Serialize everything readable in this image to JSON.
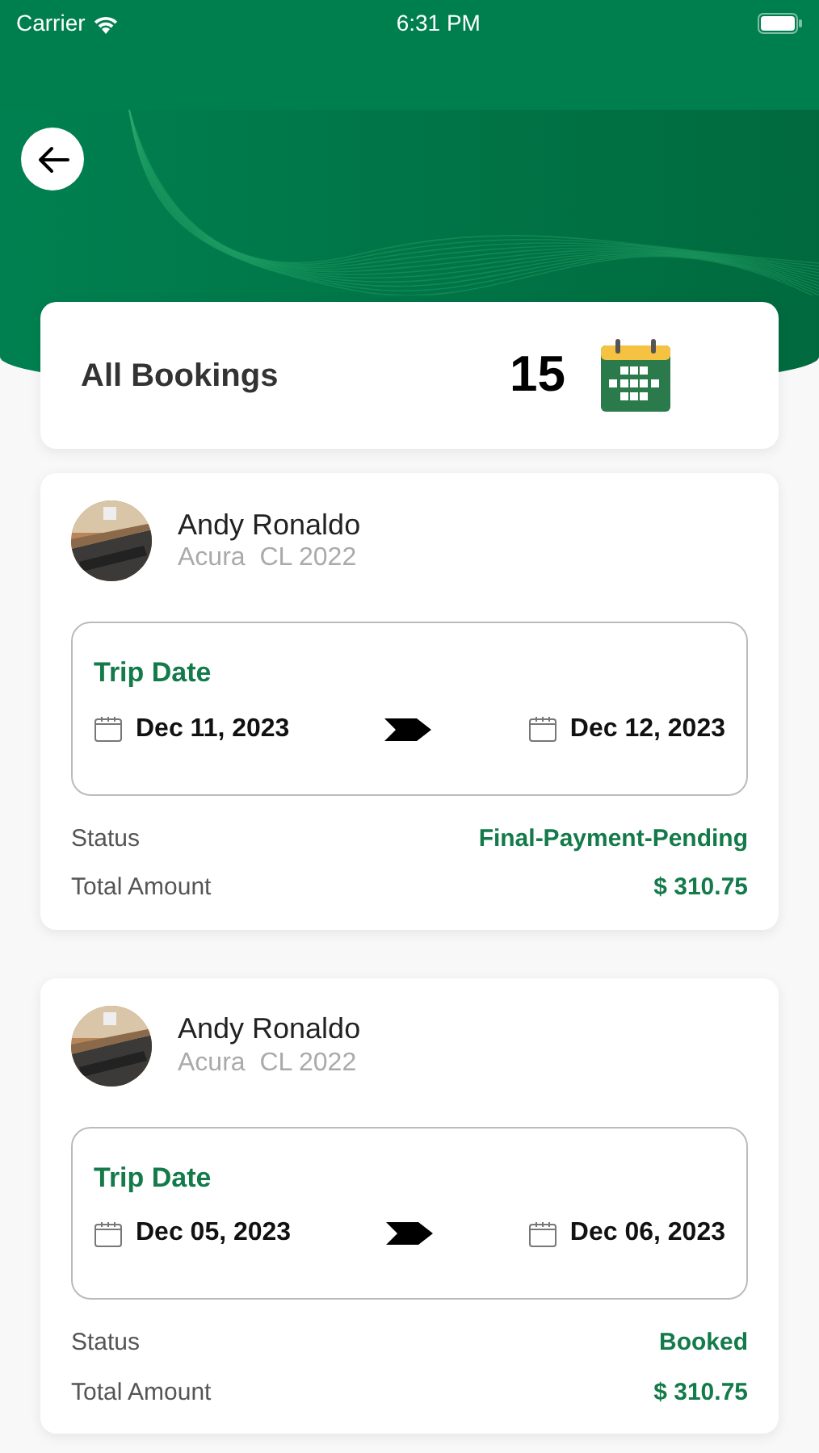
{
  "status_bar": {
    "carrier": "Carrier",
    "time": "6:31 PM"
  },
  "summary": {
    "label": "All Bookings",
    "count": "15"
  },
  "bookings": [
    {
      "name": "Andy Ronaldo",
      "vehicle": "Acura  CL 2022",
      "trip_label": "Trip Date",
      "start_date": "Dec 11, 2023",
      "end_date": "Dec 12, 2023",
      "status_label": "Status",
      "status": "Final-Payment-Pending",
      "amount_label": "Total Amount",
      "amount": "$ 310.75"
    },
    {
      "name": "Andy Ronaldo",
      "vehicle": "Acura  CL 2022",
      "trip_label": "Trip Date",
      "start_date": "Dec 05, 2023",
      "end_date": "Dec 06, 2023",
      "status_label": "Status",
      "status": "Booked",
      "amount_label": "Total Amount",
      "amount": "$ 310.75"
    }
  ]
}
